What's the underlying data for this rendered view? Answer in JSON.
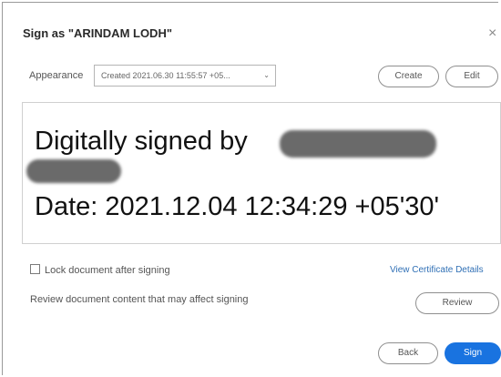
{
  "dialog": {
    "title": "Sign as \"ARINDAM LODH\"",
    "close_glyph": "×"
  },
  "appearance": {
    "label": "Appearance",
    "selected": "Created 2021.06.30 11:55:57 +05...",
    "create_label": "Create",
    "edit_label": "Edit"
  },
  "preview": {
    "line1": "Digitally signed by",
    "date_line": "Date: 2021.12.04 12:34:29 +05'30'",
    "redaction_color": "#6a6a6a"
  },
  "options": {
    "lock_label": "Lock document after signing",
    "lock_checked": false,
    "view_cert_label": "View Certificate Details"
  },
  "review": {
    "text": "Review document content that may affect signing",
    "button_label": "Review"
  },
  "footer": {
    "back_label": "Back",
    "sign_label": "Sign"
  },
  "colors": {
    "accent": "#1973e0",
    "link": "#2f6fb5"
  }
}
